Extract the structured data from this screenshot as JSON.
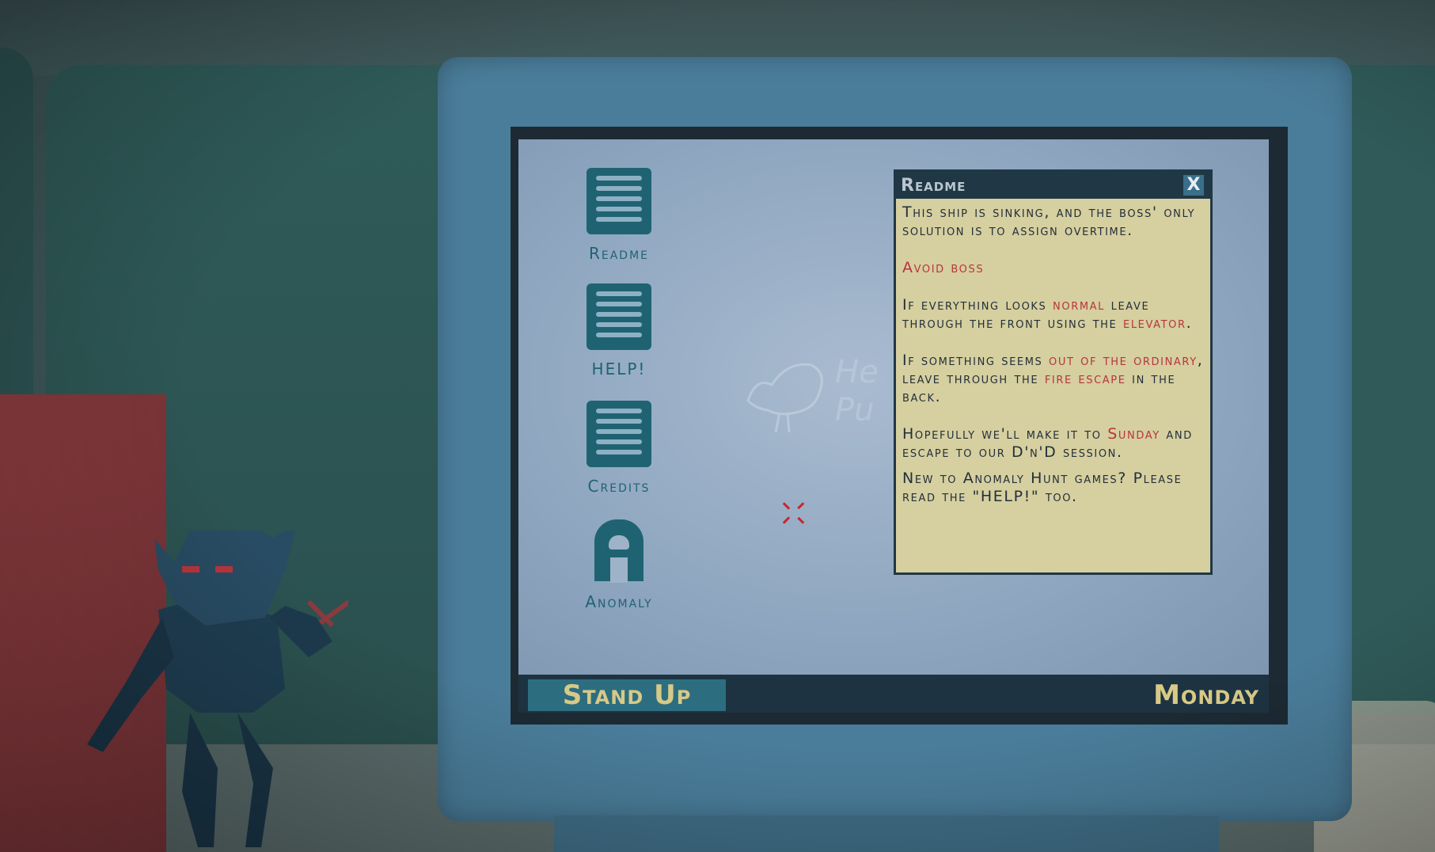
{
  "desktop": {
    "icons": [
      {
        "label": "Readme",
        "icon": "document-icon"
      },
      {
        "label": "HELP!",
        "icon": "document-icon"
      },
      {
        "label": "Credits",
        "icon": "document-icon"
      },
      {
        "label": "Anomaly",
        "icon": "arch-icon"
      }
    ],
    "watermark": {
      "line1": "He",
      "line2": "Pu"
    }
  },
  "readme_window": {
    "title": "Readme",
    "close_label": "X",
    "p1": "This ship is sinking, and the boss' only solution is to assign overtime.",
    "p2": "Avoid boss",
    "p3_a": "If everything looks ",
    "p3_hl1": "normal",
    "p3_b": " leave through the front using the ",
    "p3_hl2": "elevator",
    "p3_c": ".",
    "p4_a": "If something seems ",
    "p4_hl1": "out of the ordinary",
    "p4_b": ", leave through the ",
    "p4_hl2": "fire escape",
    "p4_c": " in the back.",
    "p5_a": "Hopefully we'll make it to ",
    "p5_hl": "Sunday",
    "p5_b": " and escape to our D'n'D session.",
    "p6": "New to Anomaly Hunt games? Please read the \"HELP!\" too."
  },
  "taskbar": {
    "stand_up_label": "Stand Up",
    "day": "Monday"
  },
  "colors": {
    "highlight": "#b8353d",
    "icon_teal": "#1f6372",
    "taskbar_text": "#d8c987"
  }
}
